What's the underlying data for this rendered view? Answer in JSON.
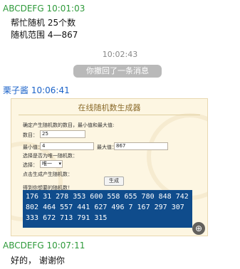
{
  "messages": {
    "m1": {
      "sender": "ABCDEFG",
      "time": "10:01:03",
      "lines": [
        "帮忙随机 25个数",
        "随机范围 4—867"
      ]
    },
    "system": {
      "time": "10:02:43",
      "recall_text": "你撤回了一条消息"
    },
    "m2": {
      "sender": "栗子酱",
      "time": "10:06:41"
    },
    "m3": {
      "sender": "ABCDEFG",
      "time": "10:07:11",
      "text": "好的， 谢谢你"
    }
  },
  "screenshot": {
    "title": "在线随机数生成器",
    "instruction": "确定产生随机数的数目，最小值和最大值:",
    "count_label": "数目：",
    "count_value": "25",
    "min_label": "最小值：",
    "min_value": "4",
    "max_label": "最大值：",
    "max_value": "867",
    "repeat_label": "选择是否为唯一随机数：",
    "select_label": "选择：",
    "select_value": "唯一",
    "click_hint": "点击生成产生随机数：",
    "generate_label": "生成",
    "result_label": "得到你想要的随机数！",
    "results": "176 31 278 353 600 558 655 780 848 742 802 464 557 441 627 496 7 167 297 307 333 672 713 791 315",
    "zoom_icon": "zoom-in-icon"
  }
}
